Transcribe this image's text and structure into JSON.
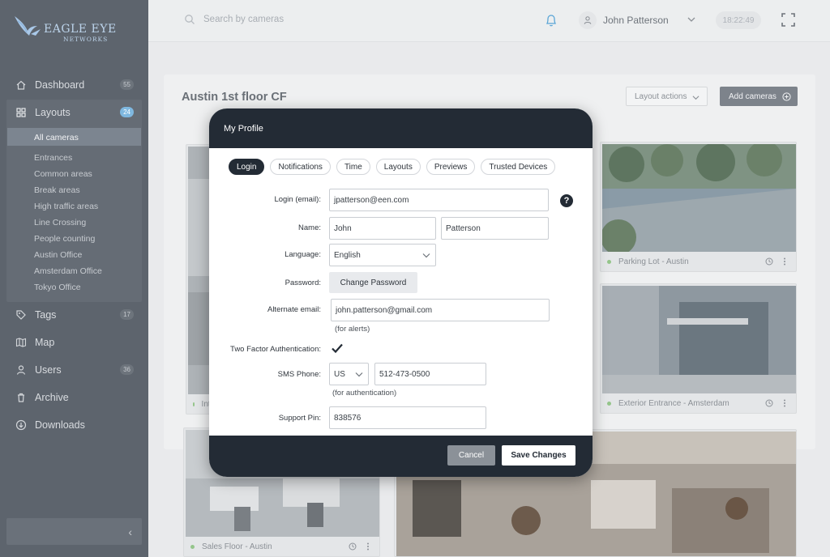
{
  "brand": {
    "line1": "EAGLE EYE",
    "line2": "NETWORKS"
  },
  "sidebar": {
    "items": [
      {
        "label": "Dashboard",
        "count": "55"
      },
      {
        "label": "Layouts",
        "count": "24"
      },
      {
        "label": "Tags",
        "count": "17"
      },
      {
        "label": "Map",
        "count": ""
      },
      {
        "label": "Users",
        "count": "36"
      },
      {
        "label": "Archive",
        "count": ""
      },
      {
        "label": "Downloads",
        "count": ""
      }
    ],
    "layouts": [
      "All cameras",
      "Entrances",
      "Common areas",
      "Break areas",
      "High traffic areas",
      "Line Crossing",
      "People counting",
      "Austin Office",
      "Amsterdam Office",
      "Tokyo Office"
    ],
    "collapse_icon": "‹"
  },
  "topbar": {
    "search_placeholder": "Search by cameras",
    "user_name": "John Patterson",
    "clock": "18:22:49"
  },
  "main": {
    "title": "Austin 1st floor CF",
    "layout_actions": "Layout actions",
    "add_cameras": "Add cameras",
    "cameras": [
      {
        "name": "Int..."
      },
      {
        "name": "Parking Lot - Austin"
      },
      {
        "name": "Exterior Entrance - Amsterdam"
      },
      {
        "name": "Sales Floor - Austin"
      }
    ]
  },
  "modal": {
    "title": "My Profile",
    "tabs": [
      "Login",
      "Notifications",
      "Time",
      "Layouts",
      "Previews",
      "Trusted Devices"
    ],
    "labels": {
      "login": "Login (email):",
      "name": "Name:",
      "language": "Language:",
      "password": "Password:",
      "alt_email": "Alternate email:",
      "two_factor": "Two Factor Authentication:",
      "sms": "SMS Phone:",
      "pin": "Support Pin:"
    },
    "values": {
      "login": "jpatterson@een.com",
      "first_name": "John",
      "last_name": "Patterson",
      "language": "English",
      "alt_email": "john.patterson@gmail.com",
      "country": "US",
      "phone": "512-473-0500",
      "pin": "838576"
    },
    "change_password": "Change Password",
    "alt_email_hint": "(for alerts)",
    "sms_hint": "(for authentication)",
    "help": "?",
    "cancel": "Cancel",
    "save": "Save Changes"
  }
}
